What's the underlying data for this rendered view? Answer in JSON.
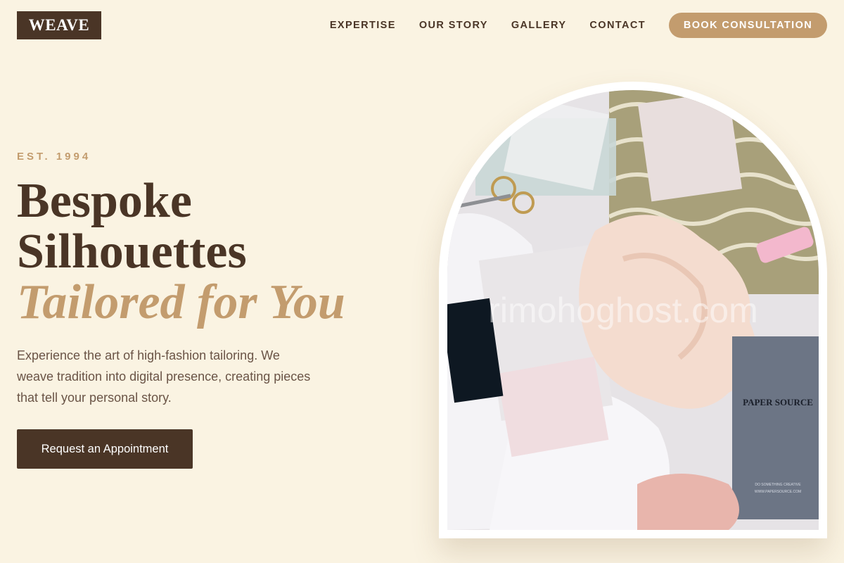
{
  "header": {
    "logo": "WEAVE",
    "nav": [
      {
        "label": "EXPERTISE"
      },
      {
        "label": "OUR STORY"
      },
      {
        "label": "GALLERY"
      },
      {
        "label": "CONTACT"
      }
    ],
    "cta": "BOOK CONSULTATION"
  },
  "hero": {
    "eyebrow": "EST. 1994",
    "title_line1": "Bespoke",
    "title_line2": "Silhouettes",
    "title_accent": "Tailored for You",
    "description": "Experience the art of high-fashion tailoring. We weave tradition into digital presence, creating pieces that tell your personal story.",
    "button": "Request an Appointment"
  },
  "image": {
    "watermark": "rimohoghost.com",
    "notebook_title": "PAPER SOURCE",
    "notebook_footer": "DO SOMETHING CREATIVE",
    "notebook_url": "WWW.PAPERSOURCE.COM"
  },
  "colors": {
    "background": "#faf3e2",
    "brown": "#4a3526",
    "gold": "#c39c6e"
  }
}
